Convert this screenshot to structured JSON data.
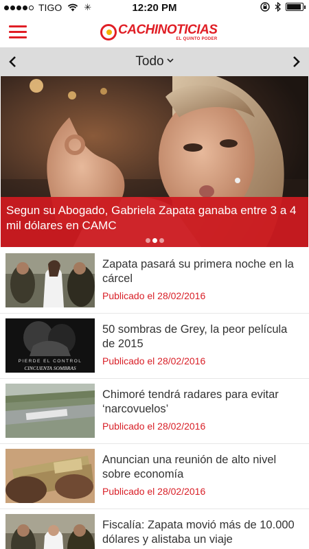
{
  "status_bar": {
    "carrier": "TIGO",
    "time": "12:20 PM",
    "signal_bars": 4,
    "battery_level": 0.9
  },
  "header": {
    "logo_text": "CACHINOTICIAS",
    "logo_tagline": "EL QUINTO PODER",
    "brand_color": "#e01e25"
  },
  "category_bar": {
    "selected": "Todo"
  },
  "hero": {
    "caption": "Segun su Abogado, Gabriela Zapata ganaba entre 3 a 4 mil dólares en CAMC",
    "slide_count": 3,
    "active_slide": 1
  },
  "news": [
    {
      "title": "Zapata pasará su primera noche en la cárcel",
      "date": "Publicado el 28/02/2016",
      "thumb": "arrest"
    },
    {
      "title": "50 sombras de Grey, la peor película de 2015",
      "date": "Publicado el 28/02/2016",
      "thumb": "movie",
      "thumb_text_1": "PIERDE EL CONTROL",
      "thumb_text_2": "CINCUENTA SOMBRAS"
    },
    {
      "title": "Chimoré tendrá radares para evitar ‘narcovuelos’",
      "date": "Publicado el 28/02/2016",
      "thumb": "airport"
    },
    {
      "title": "Anuncian una reunión de alto nivel sobre economía",
      "date": "Publicado el 28/02/2016",
      "thumb": "money"
    },
    {
      "title": "Fiscalía: Zapata movió más de 10.000 dólares y alistaba un viaje",
      "date": "",
      "thumb": "arrest2"
    }
  ]
}
